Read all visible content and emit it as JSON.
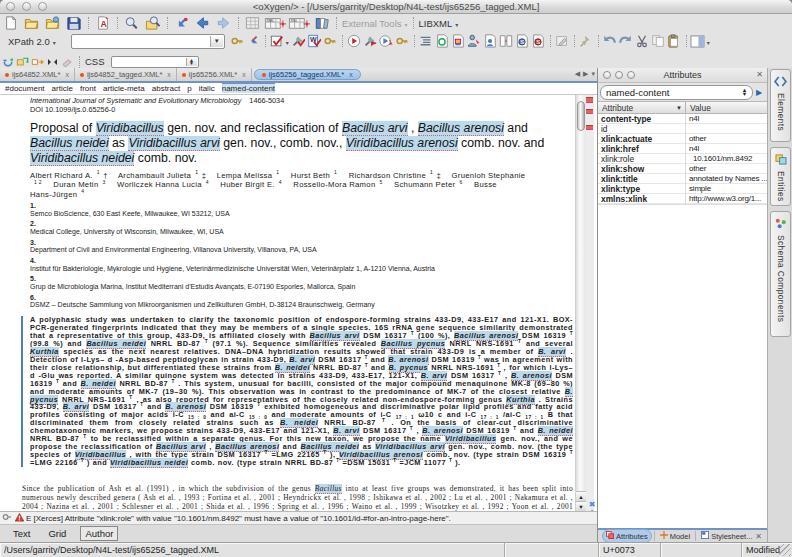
{
  "window": {
    "title": "<oXygen/> -  [/Users/garrity/Desktop/N4L-test/ijs65256_tagged.XML]"
  },
  "toolbar": {
    "external_tools_label": "External Tools",
    "libxml_label": "LIBXML",
    "xpath_label": "XPath 2.0",
    "xpath_value": "",
    "css_label": "CSS",
    "css_value": ""
  },
  "tabs": {
    "items": [
      {
        "label": "ijs64852.XML*"
      },
      {
        "label": "ijs64852_tagged.XML*"
      },
      {
        "label": "ijs65256.XML*"
      },
      {
        "label": "ijs65256_tagged.XML*",
        "active": true
      }
    ],
    "close_glyph": "x"
  },
  "breadcrumb": {
    "items": [
      "#document",
      "article",
      "front",
      "article-meta",
      "abstract",
      "p",
      "italic",
      "named-content"
    ],
    "active_index": 7
  },
  "document": {
    "journal": [
      [
        "i",
        "International Journal of Systematic and Evolutionary Microbiology"
      ],
      [
        "issn",
        "1466-5034"
      ]
    ],
    "doi": "DOI 10.1099/ijs.0.65256-0",
    "title": [
      [
        "",
        "Proposal of "
      ],
      [
        "hl",
        "Viridibacillus"
      ],
      [
        "",
        " gen. nov. and reclassification of "
      ],
      [
        "hl",
        "Bacillus arvi"
      ],
      [
        "",
        " , "
      ],
      [
        "hl",
        "Bacillus arenosi"
      ],
      [
        "",
        " and "
      ],
      [
        "hl",
        "Bacillus neidei"
      ],
      [
        "",
        " as "
      ],
      [
        "hl",
        "Viridibacillus arvi"
      ],
      [
        "",
        " gen. nov., comb. nov., "
      ],
      [
        "hl",
        "Viridibacillus arenosi"
      ],
      [
        "",
        " comb. nov. and "
      ],
      [
        "hl",
        "Viridibacillus neidei"
      ],
      [
        "",
        " comb. nov."
      ]
    ],
    "authors": [
      [
        "",
        "Albert Richard A."
      ],
      [
        "sup",
        "1"
      ],
      [
        "",
        " †  Archambault Julieta"
      ],
      [
        "sup",
        "1"
      ],
      [
        "",
        " ‡  Lempa Melissa"
      ],
      [
        "sup",
        "1"
      ],
      [
        "",
        "  Hurst Beth"
      ],
      [
        "sup",
        "1"
      ],
      [
        "",
        "  Richardson Christine"
      ],
      [
        "sup",
        "1"
      ],
      [
        "",
        " ‡  Gruenloh Stephanie"
      ],
      [
        "br",
        ""
      ],
      [
        "sup",
        "1  2"
      ],
      [
        "",
        "  Duran Metin"
      ],
      [
        "sup",
        "3"
      ],
      [
        "",
        "  Worliczek Hanna Lucia"
      ],
      [
        "sup",
        "4"
      ],
      [
        "",
        "  Huber Birgit E."
      ],
      [
        "sup",
        "4"
      ],
      [
        "",
        "  Rossello-Mora Ramon"
      ],
      [
        "sup",
        "5"
      ],
      [
        "",
        "  Schumann Peter"
      ],
      [
        "sup",
        "6"
      ],
      [
        "",
        "  Busse"
      ],
      [
        "br",
        ""
      ],
      [
        "",
        "Hans-Jürgen"
      ],
      [
        "sup",
        "4"
      ]
    ],
    "affiliations": [
      {
        "num": "1.",
        "text": "Semco BioScience, 630 East Keefe, Milwaukee, WI 53212, USA"
      },
      {
        "num": "2.",
        "text": "Medical College, University of Wisconsin, Milwaukee, WI, USA"
      },
      {
        "num": "3.",
        "text": "Department of Civil and Environmental Engineering, Villanova University, Villanova, PA, USA"
      },
      {
        "num": "4.",
        "text": "Institut für Bakteriologie, Mykrologie und Hygiene, Veterinärmedizinische Universität Wien, Veterinärplatz 1, A-1210 Vienna, Austria"
      },
      {
        "num": "5.",
        "text": "Grup de Microbiologia Marina, Institut Mediterrani d'Estudis Avançats, E-07190 Esporles, Mallorca, Spain"
      },
      {
        "num": "6.",
        "text": "DSMZ – Deutsche Sammlung von Mikroorganismen und Zellkulturen GmbH, D-38124 Braunschweig, Germany"
      }
    ],
    "abstract": [
      [
        "",
        "A polyphasic study was undertaken to clarify the taxonomic position of endospore-forming strains 433-D9, 433-E17 and 121-X1. BOX-PCR-generated fingerprints indicated that they may be members of a single species. 16S rRNA gene sequence similarity demonstrated that a representative of this group, 433-D9, is affiliated closely with "
      ],
      [
        "hl",
        "Bacillus arvi"
      ],
      [
        "",
        " DSM 16317 "
      ],
      [
        "sup",
        "T"
      ],
      [
        "",
        " (100 %), "
      ],
      [
        "hl",
        "Bacillus arenosi"
      ],
      [
        "",
        " DSM 16319 "
      ],
      [
        "sup",
        "T"
      ],
      [
        "",
        " (99.8 %) and "
      ],
      [
        "hl",
        "Bacillus neidei"
      ],
      [
        "",
        " NRRL BD-87 "
      ],
      [
        "sup",
        "T"
      ],
      [
        "",
        " (97.1 %). Sequence similarities revealed "
      ],
      [
        "hl",
        "Bacillus pycnus"
      ],
      [
        "",
        " NRRL NRS-1691 "
      ],
      [
        "sup",
        "T"
      ],
      [
        "",
        " and several "
      ],
      [
        "hl",
        "Kurthia"
      ],
      [
        "",
        " species as the next nearest relatives. DNA–DNA hybridization results showed that strain 433-D9 is a member of "
      ],
      [
        "hl",
        "B. arvi"
      ],
      [
        "",
        " . Detection of l-Lys– d -Asp-based peptidoglycan in strain 433-D9, "
      ],
      [
        "hl",
        "B. arvi"
      ],
      [
        "",
        " DSM 16317 "
      ],
      [
        "sup",
        "T"
      ],
      [
        "",
        " and "
      ],
      [
        "hl",
        "B. arenosi"
      ],
      [
        "",
        " DSM 16319 "
      ],
      [
        "sup",
        "T"
      ],
      [
        "",
        " was in agreement with their close relationship, but differentiated these strains from "
      ],
      [
        "hl",
        "B. neidei"
      ],
      [
        "",
        " NRRL BD-87 "
      ],
      [
        "sup",
        "T"
      ],
      [
        "",
        " and "
      ],
      [
        "hl",
        "B. pycnus"
      ],
      [
        "",
        " NRRL NRS-1691 "
      ],
      [
        "sup",
        "T"
      ],
      [
        "",
        " , for which l-Lys– d -Glu was reported. A similar quinone system was detected in strains 433-D9, 433-E17, 121-X1, "
      ],
      [
        "hl",
        "B. arvi"
      ],
      [
        "",
        " DSM 16317 "
      ],
      [
        "sup",
        "T"
      ],
      [
        "",
        " , "
      ],
      [
        "hl",
        "B. arenosi"
      ],
      [
        "",
        " DSM 16319 "
      ],
      [
        "sup",
        "T"
      ],
      [
        "",
        " and "
      ],
      [
        "hl",
        "B. neidei"
      ],
      [
        "",
        " NRRL BD-87 "
      ],
      [
        "sup",
        "T"
      ],
      [
        "",
        " . This system, unusual for bacilli, consisted of the major compound menaquinone MK-8 (69–80 %) and moderate amounts of MK-7 (19–30 %). This observation was in contrast to the predominance of MK-7 of the closest relative "
      ],
      [
        "hl",
        "B. pycnus"
      ],
      [
        "",
        " NRRL NRS-1691 "
      ],
      [
        "sup",
        "T"
      ],
      [
        "",
        " , as also reported for representatives of the closely related non-endospore-forming genus "
      ],
      [
        "hl",
        "Kurthia"
      ],
      [
        "",
        " . Strains 433-D9, "
      ],
      [
        "hl",
        "B. arvi"
      ],
      [
        "",
        " DSM 16317 "
      ],
      [
        "sup",
        "T"
      ],
      [
        "",
        " and "
      ],
      [
        "hl",
        "B. arenosi"
      ],
      [
        "",
        " DSM 16319 "
      ],
      [
        "sup",
        "T"
      ],
      [
        "",
        " exhibited homogeneous and discriminative polar lipid profiles and fatty acid profiles consisting of major acids i-C "
      ],
      [
        "sub",
        "15 : 0"
      ],
      [
        "",
        " and ai-C "
      ],
      [
        "sub",
        "15 : 0"
      ],
      [
        "",
        " and moderate amounts of i-C "
      ],
      [
        "sub",
        "17 : 1"
      ],
      [
        "",
        " ω10 c and i-C "
      ],
      [
        "sub",
        "17 : 1"
      ],
      [
        "",
        " /ai-C "
      ],
      [
        "sub",
        "17 : 1"
      ],
      [
        "",
        " B that discriminated them from closely related strains such as "
      ],
      [
        "hl",
        "B. neidei"
      ],
      [
        "",
        " NRRL BD-87 "
      ],
      [
        "sup",
        "T"
      ],
      [
        "",
        " . On the basis of clear-cut discriminative chemotaxonomic markers, we propose strains 433-D9, 433-E17 and 121-X1, "
      ],
      [
        "hl",
        "B. arvi"
      ],
      [
        "",
        " DSM 16317 "
      ],
      [
        "sup",
        "T"
      ],
      [
        "",
        " , "
      ],
      [
        "hl",
        "B. arenosi"
      ],
      [
        "",
        " DSM 16319 "
      ],
      [
        "sup",
        "T"
      ],
      [
        "",
        " and "
      ],
      [
        "hl",
        "B. neidei"
      ],
      [
        "",
        " NRRL BD-87 "
      ],
      [
        "sup",
        "T"
      ],
      [
        "",
        " to be reclassified within a separate genus. For this new taxon, we propose the name "
      ],
      [
        "hl",
        "Viridibacillus"
      ],
      [
        "",
        " gen. nov., and we propose the reclassification of "
      ],
      [
        "hl",
        "Bacillus arvi"
      ],
      [
        "",
        " , "
      ],
      [
        "hl",
        "Bacillus arenosi"
      ],
      [
        "",
        " and "
      ],
      [
        "hl",
        "Bacillus neidei"
      ],
      [
        "",
        " as "
      ],
      [
        "hl",
        "Viridibacillus arvi"
      ],
      [
        "",
        " gen. nov., comb. nov. (the type species of "
      ],
      [
        "hl",
        "Viridibacillus"
      ],
      [
        "",
        " , with the type strain DSM 16317 "
      ],
      [
        "sup",
        "T"
      ],
      [
        "",
        " =LMG 22165 "
      ],
      [
        "sup",
        "T"
      ],
      [
        "",
        " ), "
      ],
      [
        "hl",
        "Viridibacillus arenosi"
      ],
      [
        "",
        " comb. nov. (type strain DSM 16319 "
      ],
      [
        "sup",
        "T"
      ],
      [
        "",
        " =LMG 22166 "
      ],
      [
        "sup",
        "T"
      ],
      [
        "",
        " ) and "
      ],
      [
        "hl",
        "Viridibacillus neidei"
      ],
      [
        "",
        " comb. nov. (type strain NRRL BD-87 "
      ],
      [
        "sup",
        "T"
      ],
      [
        "",
        " =DSM 15031 "
      ],
      [
        "sup",
        "T"
      ],
      [
        "",
        " =JCM 11077 "
      ],
      [
        "sup",
        "T"
      ],
      [
        "",
        " )."
      ]
    ],
    "body": [
      [
        "",
        "Since the publication of Ash "
      ],
      [
        "i",
        "et al."
      ],
      [
        "",
        " (1991) , in which the subdivision of the genus "
      ],
      [
        "hl",
        "Bacillus"
      ],
      [
        "",
        " into at least five groups was demonstrated, it has been split into numerous newly described genera ( Ash "
      ],
      [
        "i",
        "et al."
      ],
      [
        "",
        " , 1993 ; Fortina "
      ],
      [
        "i",
        "et al."
      ],
      [
        "",
        " , 2001 ; Heyndrickx "
      ],
      [
        "i",
        "et al."
      ],
      [
        "",
        " , 1998 ; Ishikawa "
      ],
      [
        "i",
        "et al."
      ],
      [
        "",
        " , 2002 ; Lu "
      ],
      [
        "i",
        "et al."
      ],
      [
        "",
        " , 2001 ; Nakamura "
      ],
      [
        "i",
        "et al."
      ],
      [
        "",
        " , 2004 ; Nazina "
      ],
      [
        "i",
        "et al."
      ],
      [
        "",
        " , 2001 ; Schlesner "
      ],
      [
        "i",
        "et al."
      ],
      [
        "",
        " , 2001 ; Shida "
      ],
      [
        "i",
        "et al."
      ],
      [
        "",
        " , 1996 ; Spring "
      ],
      [
        "i",
        "et al."
      ],
      [
        "",
        " , 1996 ; Waino "
      ],
      [
        "i",
        "et al."
      ],
      [
        "",
        " , 1999 ; Wisotzkey "
      ],
      [
        "i",
        "et al."
      ],
      [
        "",
        " , 1992 ; Yoon "
      ],
      [
        "i",
        "et al."
      ],
      [
        "",
        " , 2001 )."
      ]
    ]
  },
  "error_bar": {
    "severity": "E",
    "text": "E [Xerces] Attribute \"xlink:role\" with value \"10.1601/nm.8492\" must have a value of \"10.1601/id-#for-an-intro-page-here\"."
  },
  "mode_tabs": {
    "items": [
      {
        "label": "Text"
      },
      {
        "label": "Grid"
      },
      {
        "label": "Author",
        "active": true
      }
    ]
  },
  "status_bar": {
    "path": "/Users/garrity/Desktop/N4L-test/ijs65256_tagged.XML",
    "unicode": "U+0073",
    "state": "Modified"
  },
  "attributes_panel": {
    "title": "Attributes",
    "element_combo_value": "named-content",
    "columns": [
      "Attribute",
      "Value"
    ],
    "rows": [
      {
        "name": "content-type",
        "value": "n4l",
        "bold": true
      },
      {
        "name": "id",
        "value": "",
        "bold": false
      },
      {
        "name": "xlink:actuate",
        "value": "other",
        "bold": true
      },
      {
        "name": "xlink:href",
        "value": "n4l",
        "bold": true
      },
      {
        "name": "xlink:role",
        "value": "10.1601/nm.8492",
        "bold": false,
        "editing": true
      },
      {
        "name": "xlink:show",
        "value": "other",
        "bold": true
      },
      {
        "name": "xlink:title",
        "value": "annotated by Names ...",
        "bold": true
      },
      {
        "name": "xlink:type",
        "value": "simple",
        "bold": true
      },
      {
        "name": "xmlns:xlink",
        "value": "http://www.w3.org/1...",
        "bold": true
      }
    ],
    "bottom_tabs": [
      {
        "label": "Attributes",
        "active": true
      },
      {
        "label": "Model"
      },
      {
        "label": "Stylesheet..."
      }
    ]
  },
  "side_tabs": {
    "items": [
      {
        "label": "Elements"
      },
      {
        "label": "Entities"
      },
      {
        "label": "Schema Components"
      }
    ]
  },
  "colors": {
    "accent_blue": "#6f94c4",
    "tab_active": "#a9c6e7",
    "highlight": "#bdd9ec",
    "error_red": "#d9534f",
    "modified_dot": "#e86a1a"
  }
}
